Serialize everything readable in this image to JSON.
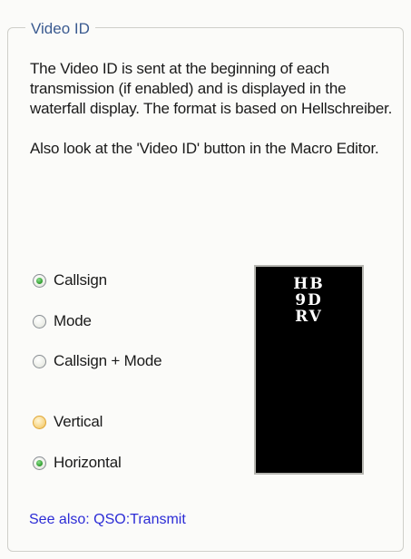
{
  "group": {
    "title": "Video ID"
  },
  "description": {
    "paragraph1": "The Video ID is sent at the beginning of each transmission (if enabled) and is displayed in the waterfall display. The format is based on Hellschreiber.",
    "paragraph2": "Also look at the 'Video ID' button in the Macro Editor."
  },
  "content_options": [
    {
      "label": "Callsign",
      "selected": true
    },
    {
      "label": "Mode",
      "selected": false
    },
    {
      "label": "Callsign + Mode",
      "selected": false
    }
  ],
  "orientation_options": [
    {
      "label": "Vertical",
      "selected": false
    },
    {
      "label": "Horizontal",
      "selected": true
    }
  ],
  "preview": {
    "lines": [
      "HB",
      "9D",
      "RV"
    ]
  },
  "see_also": {
    "text": "See also: QSO:Transmit"
  },
  "colors": {
    "group_title": "#3a5a90",
    "link": "#2c2cd6",
    "radio_checked": "#2b9a2b",
    "radio_hover": "#e8b648",
    "preview_bg": "#000000"
  }
}
